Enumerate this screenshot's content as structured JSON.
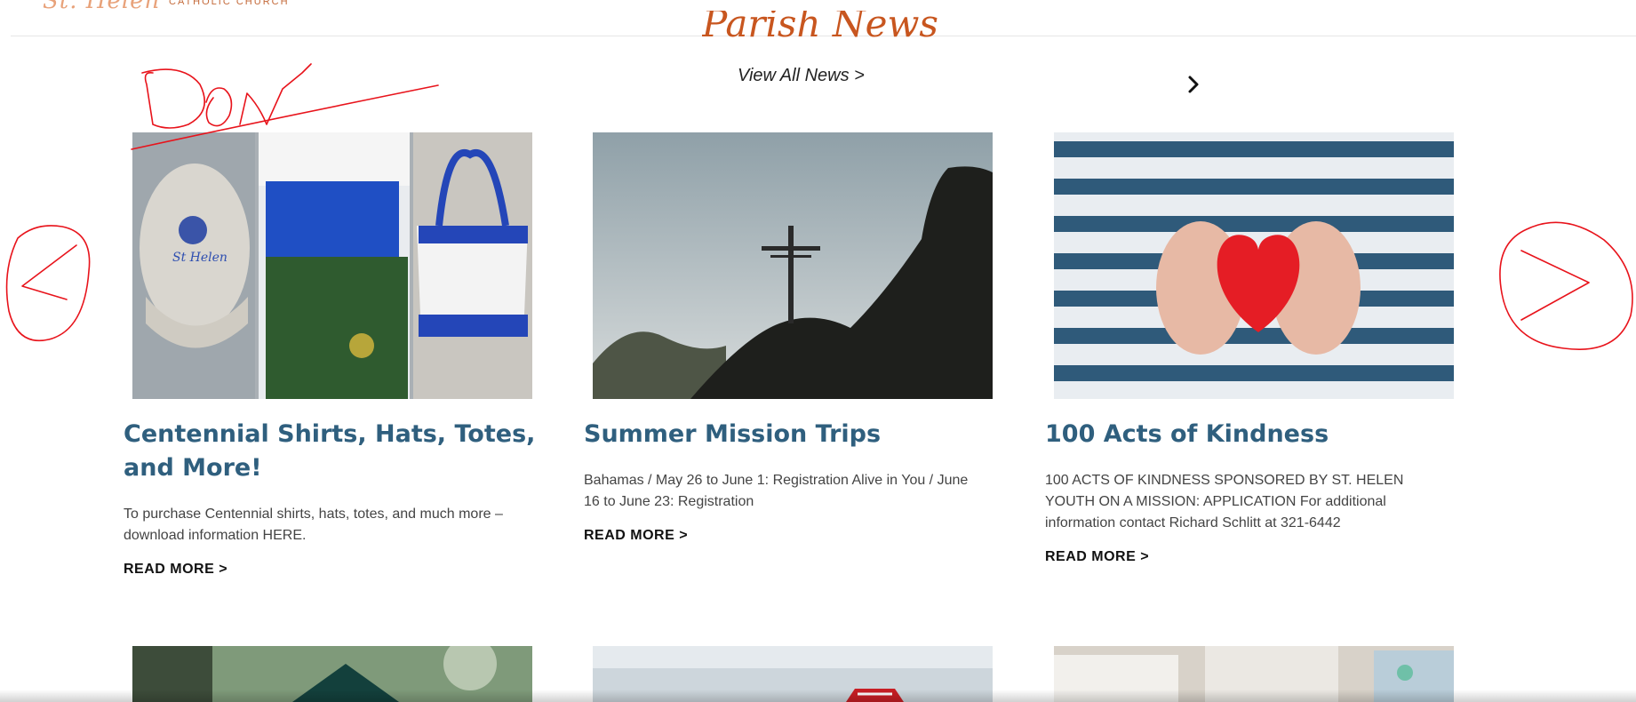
{
  "header": {
    "logo_text": "St. Helen",
    "logo_sub": "CATHOLIC CHURCH"
  },
  "news": {
    "section_title": "Parish News",
    "view_all": "View All News >",
    "next_icon": "chevron-right-icon",
    "cards": [
      {
        "title": "Centennial Shirts, Hats, Totes, and More!",
        "excerpt": "To purchase Centennial shirts, hats, totes, and much more – download information HERE.",
        "read_more": "READ MORE >"
      },
      {
        "title": "Summer Mission Trips",
        "excerpt": "Bahamas / May 26 to June 1: Registration Alive in You / June 16 to June 23: Registration",
        "read_more": "READ MORE >"
      },
      {
        "title": "100 Acts of Kindness",
        "excerpt": " 100 ACTS OF KINDNESS SPONSORED BY ST. HELEN YOUTH ON A MISSION: APPLICATION For additional information contact Richard Schlitt at 321-6442",
        "read_more": "READ MORE >"
      }
    ]
  },
  "annotations": {
    "color": "#e8131b",
    "handwritten_text": "Don"
  },
  "colors": {
    "title_blue": "#2f5f7e",
    "section_orange": "#c8561f"
  }
}
